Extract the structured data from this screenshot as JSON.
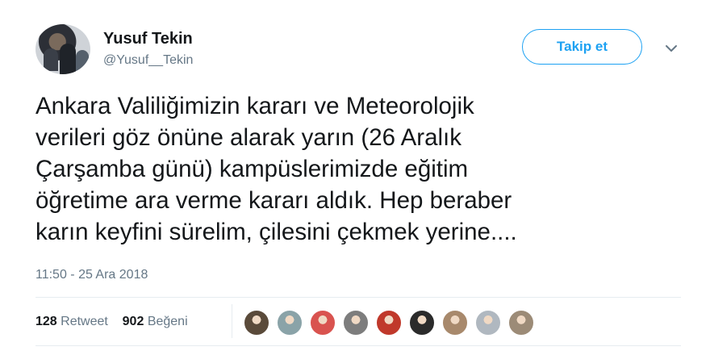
{
  "user": {
    "name": "Yusuf Tekin",
    "handle": "@Yusuf__Tekin"
  },
  "actions": {
    "follow_label": "Takip et"
  },
  "tweet": {
    "lines": [
      "Ankara Valiliğimizin kararı ve Meteorolojik",
      "verileri göz önüne alarak yarın (26 Aralık",
      "Çarşamba günü) kampüslerimizde eğitim",
      "öğretime ara verme kararı aldık. Hep beraber",
      "karın keyfini sürelim, çilesini çekmek yerine...."
    ],
    "timestamp": "11:50 - 25 Ara 2018"
  },
  "stats": {
    "retweets_count": "128",
    "retweets_label": "Retweet",
    "likes_count": "902",
    "likes_label": "Beğeni"
  },
  "likers": [
    {
      "color": "#5a4a3a"
    },
    {
      "color": "#8aa3a8"
    },
    {
      "color": "#d9534f"
    },
    {
      "color": "#7d7d7d"
    },
    {
      "color": "#c0392b"
    },
    {
      "color": "#2b2b2b"
    },
    {
      "color": "#a8896c"
    },
    {
      "color": "#b0b8c0"
    },
    {
      "color": "#9c8b77"
    }
  ],
  "colors": {
    "accent": "#1da1f2",
    "text": "#14171a",
    "muted": "#657786"
  }
}
